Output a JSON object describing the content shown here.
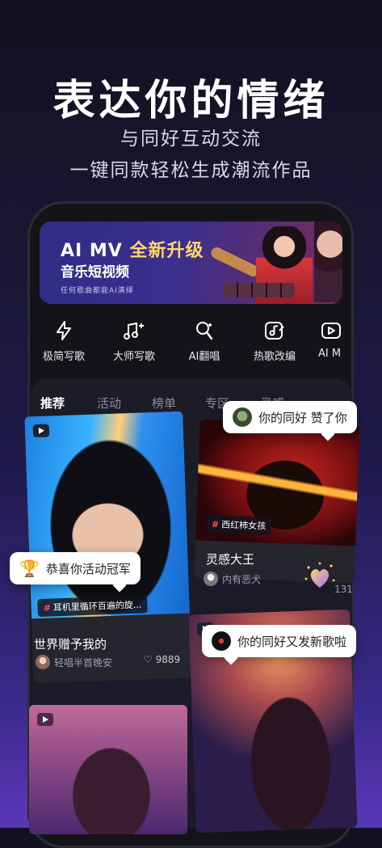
{
  "headline": {
    "title": "表达你的情绪",
    "line1": "与同好互动交流",
    "line2": "一键同款轻松生成潮流作品"
  },
  "banner": {
    "title_prefix": "AI MV ",
    "title_highlight": "全新升级",
    "subtitle": "音乐短视频",
    "caption": "任何歌曲都能AI演绎"
  },
  "features": [
    {
      "label": "极简写歌",
      "icon": "lightning-icon"
    },
    {
      "label": "大师写歌",
      "icon": "music-notes-icon"
    },
    {
      "label": "AI翻唱",
      "icon": "microphone-icon"
    },
    {
      "label": "热歌改编",
      "icon": "edit-note-icon"
    },
    {
      "label": "AI M",
      "icon": "video-play-icon"
    }
  ],
  "tabs": [
    "推荐",
    "活动",
    "榜单",
    "专区",
    "灵感"
  ],
  "cards": {
    "left_top": {
      "tag": "耳机里循环百遍的旋...",
      "title": "世界赠予我的",
      "user": "轻唱半首晚安",
      "likes": "9889"
    },
    "right_top": {
      "tag": "西红柿女孩",
      "title": "灵感大王",
      "user": "内有恶犬",
      "likes": "131"
    }
  },
  "bubbles": {
    "like": "你的同好 赞了你",
    "champion": "恭喜你活动冠军",
    "new_song": "你的同好又发新歌啦"
  },
  "colors": {
    "accent_red": "#ff4d5e",
    "banner_highlight": "#ffd66a"
  }
}
